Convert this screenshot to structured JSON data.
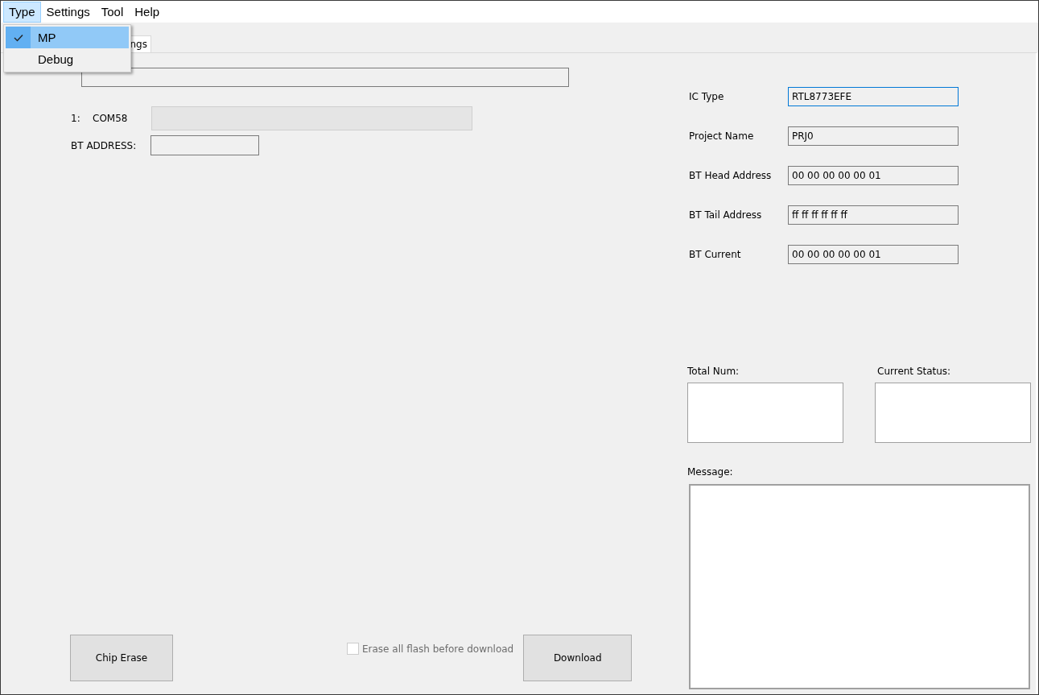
{
  "menu_bar": [
    {
      "label": "Type",
      "selected": true
    },
    {
      "label": "Settings",
      "selected": false
    },
    {
      "label": "Tool",
      "selected": false
    },
    {
      "label": "Help",
      "selected": false
    }
  ],
  "type_menu": [
    {
      "label": "MP",
      "checked": true,
      "selected": true
    },
    {
      "label": "Debug",
      "checked": false,
      "selected": false
    }
  ],
  "tab": {
    "label": "ngs"
  },
  "left_panel": {
    "ports": [
      {
        "index": "1:",
        "port": "COM58"
      }
    ],
    "bt_address_label": "BT ADDRESS:"
  },
  "bottom": {
    "chip_erase": "Chip Erase",
    "erase_checkbox": {
      "label": "Erase all flash before download",
      "checked": false,
      "disabled": true
    },
    "download": "Download"
  },
  "info_fields": [
    {
      "label": "IC Type",
      "value": "RTL8773EFE",
      "focused": true
    },
    {
      "label": "Project Name",
      "value": "PRJ0",
      "focused": false
    },
    {
      "label": "BT Head Address",
      "value": "00 00 00 00 00 01",
      "focused": false
    },
    {
      "label": "BT Tail Address",
      "value": "ff ff ff ff ff ff",
      "focused": false
    },
    {
      "label": "BT Current",
      "value": "00 00 00 00 00 01",
      "focused": false
    }
  ],
  "total_num": {
    "label": "Total Num:"
  },
  "current_status": {
    "label": "Current Status:"
  },
  "message": {
    "label": "Message:"
  }
}
